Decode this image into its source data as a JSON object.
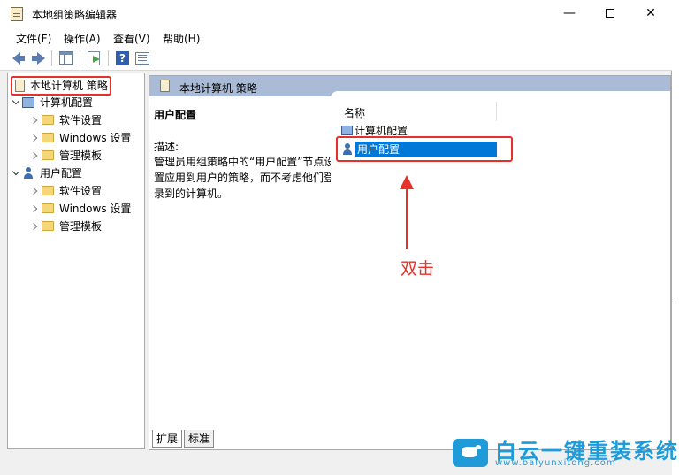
{
  "window": {
    "title": "本地组策略编辑器",
    "minimize_glyph": "—",
    "close_glyph": "✕"
  },
  "menu": [
    "文件(F)",
    "操作(A)",
    "查看(V)",
    "帮助(H)"
  ],
  "tree": {
    "root": "本地计算机 策略",
    "computer": {
      "label": "计算机配置",
      "children": [
        "软件设置",
        "Windows 设置",
        "管理模板"
      ]
    },
    "user": {
      "label": "用户配置",
      "children": [
        "软件设置",
        "Windows 设置",
        "管理模板"
      ]
    }
  },
  "details": {
    "header": "本地计算机 策略",
    "selected_title": "用户配置",
    "desc_label": "描述:",
    "desc_text": "管理员用组策略中的“用户配置”节点设置应用到用户的策略，而不考虑他们登录到的计算机。",
    "column_name": "名称",
    "items": [
      "计算机配置",
      "用户配置"
    ]
  },
  "annotation": "双击",
  "tabs": [
    "扩展",
    "标准"
  ],
  "watermark": {
    "brand": "白云一键重装系统",
    "url": "www.baiyunxitong.com"
  },
  "colors": {
    "highlight": "#e8302a",
    "selection": "#0078d7",
    "header_band": "#a9bbd6"
  }
}
